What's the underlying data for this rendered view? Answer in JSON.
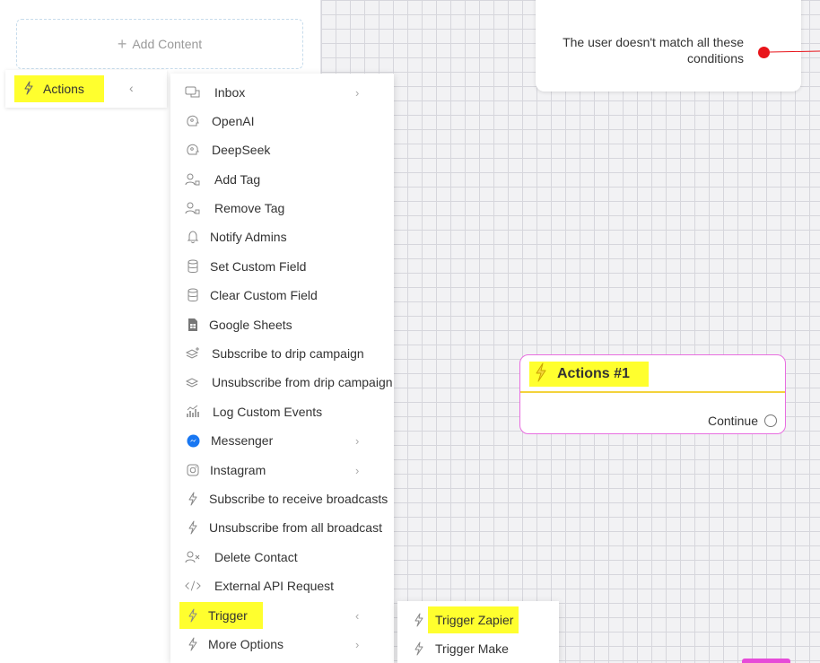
{
  "sidebar": {
    "add_content_label": "Add Content",
    "actions_label": "Actions"
  },
  "menu": {
    "items": [
      {
        "label": "Inbox",
        "icon": "chat-icon",
        "has_submenu": true
      },
      {
        "label": "OpenAI",
        "icon": "ai-brain-icon",
        "has_submenu": false
      },
      {
        "label": "DeepSeek",
        "icon": "ai-brain-icon",
        "has_submenu": false
      },
      {
        "label": "Add Tag",
        "icon": "user-tag-icon",
        "has_submenu": false
      },
      {
        "label": "Remove Tag",
        "icon": "user-tag-icon",
        "has_submenu": false
      },
      {
        "label": "Notify Admins",
        "icon": "bell-icon",
        "has_submenu": false
      },
      {
        "label": "Set Custom Field",
        "icon": "database-icon",
        "has_submenu": false
      },
      {
        "label": "Clear Custom Field",
        "icon": "database-icon",
        "has_submenu": false
      },
      {
        "label": "Google Sheets",
        "icon": "sheet-icon",
        "has_submenu": false
      },
      {
        "label": "Subscribe to drip campaign",
        "icon": "layers-plus-icon",
        "has_submenu": false
      },
      {
        "label": "Unsubscribe from drip campaign",
        "icon": "layers-icon",
        "has_submenu": false
      },
      {
        "label": "Log Custom Events",
        "icon": "chart-icon",
        "has_submenu": false
      },
      {
        "label": "Messenger",
        "icon": "messenger-icon",
        "has_submenu": true
      },
      {
        "label": "Instagram",
        "icon": "instagram-icon",
        "has_submenu": true
      },
      {
        "label": "Subscribe to receive broadcasts",
        "icon": "bolt-icon",
        "has_submenu": false
      },
      {
        "label": "Unsubscribe from all broadcast",
        "icon": "bolt-icon",
        "has_submenu": false
      },
      {
        "label": "Delete Contact",
        "icon": "user-x-icon",
        "has_submenu": false
      },
      {
        "label": "External API Request",
        "icon": "code-icon",
        "has_submenu": false
      },
      {
        "label": "Trigger",
        "icon": "bolt-icon",
        "has_submenu": true
      },
      {
        "label": "More Options",
        "icon": "bolt-icon",
        "has_submenu": true
      }
    ]
  },
  "submenu": {
    "items": [
      {
        "label": "Trigger Zapier",
        "icon": "bolt-icon"
      },
      {
        "label": "Trigger Make",
        "icon": "bolt-icon"
      }
    ]
  },
  "canvas": {
    "condition_text": "The user doesn't match all these conditions",
    "action_node_title": "Actions #1",
    "action_node_continue": "Continue"
  },
  "colors": {
    "highlight": "#ffff2e",
    "node_border": "#e86ee0",
    "node_header_line": "#f3d23c",
    "condition_dot": "#e8141a",
    "messenger": "#1877f2"
  }
}
